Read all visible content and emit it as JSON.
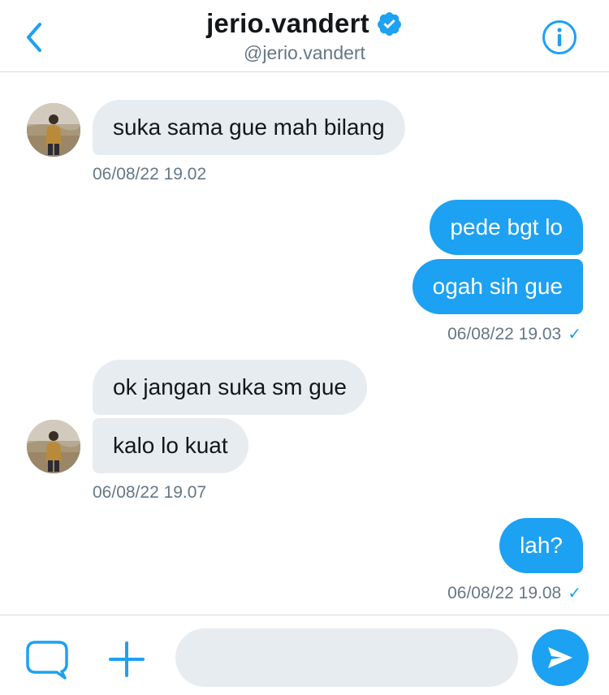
{
  "header": {
    "title": "jerio.vandert",
    "handle": "@jerio.vandert"
  },
  "colors": {
    "accent": "#1da1f2",
    "incoming_bubble": "#e6ecf0",
    "timestamp": "#657786"
  },
  "messages": [
    {
      "direction": "incoming",
      "text": "suka sama gue mah bilang"
    },
    {
      "direction": "incoming",
      "timestamp": "06/08/22 19.02"
    },
    {
      "direction": "outgoing",
      "text": "pede bgt lo"
    },
    {
      "direction": "outgoing",
      "text": "ogah sih gue"
    },
    {
      "direction": "outgoing",
      "timestamp": "06/08/22 19.03",
      "status": "✓"
    },
    {
      "direction": "incoming",
      "text": "ok jangan suka sm gue"
    },
    {
      "direction": "incoming",
      "text": "kalo lo kuat"
    },
    {
      "direction": "incoming",
      "timestamp": "06/08/22 19.07"
    },
    {
      "direction": "outgoing",
      "text": "lah?"
    },
    {
      "direction": "outgoing",
      "timestamp": "06/08/22 19.08",
      "status": "✓"
    }
  ],
  "icons": {
    "back": "chevron-left-icon",
    "verified": "verified-badge-icon",
    "info": "info-icon",
    "media": "media-icon",
    "add": "plus-icon",
    "send": "send-icon"
  },
  "composer": {
    "value": "",
    "placeholder": ""
  }
}
